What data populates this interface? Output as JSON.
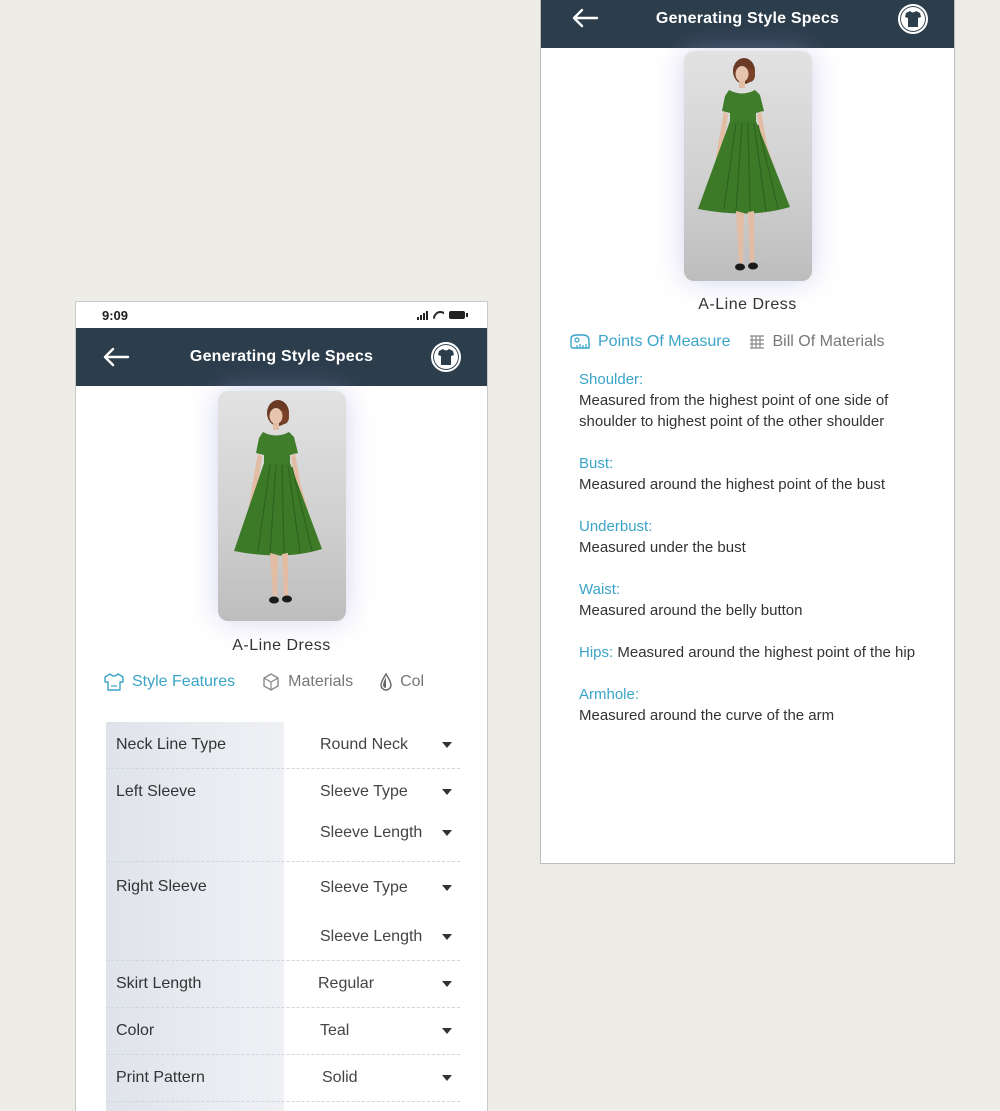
{
  "left_phone": {
    "status_bar": {
      "time": "9:09"
    },
    "header": {
      "title": "Generating Style Specs"
    },
    "product_name": "A-Line Dress",
    "tabs": [
      {
        "label": "Style Features",
        "icon": "shirt-outline-icon",
        "active": true
      },
      {
        "label": "Materials",
        "icon": "fabric-roll-icon",
        "active": false
      },
      {
        "label": "Col",
        "icon": "drop-icon",
        "active": false
      }
    ],
    "specs": [
      {
        "label": "Neck Line Type",
        "values": [
          "Round Neck"
        ]
      },
      {
        "label": "Left Sleeve",
        "values": [
          "Sleeve Type",
          "Sleeve Length"
        ]
      },
      {
        "label": "Right Sleeve",
        "values": [
          "Sleeve Type",
          "Sleeve Length"
        ]
      },
      {
        "label": "Skirt Length",
        "values": [
          "Regular"
        ]
      },
      {
        "label": "Color",
        "values": [
          "Teal"
        ]
      },
      {
        "label": "Print Pattern",
        "values": [
          "Solid"
        ]
      }
    ]
  },
  "right_phone": {
    "header": {
      "title": "Generating Style Specs"
    },
    "product_name": "A-Line Dress",
    "tabs": [
      {
        "label": "Points Of Measure",
        "icon": "measuring-tape-icon",
        "active": true
      },
      {
        "label": "Bill Of Materials",
        "icon": "grid-table-icon",
        "active": false
      }
    ],
    "measures": [
      {
        "title": "Shoulder:",
        "text": "Measured from the highest point of one side of shoulder to highest point of the other shoulder",
        "inline": false
      },
      {
        "title": "Bust:",
        "text": "Measured around the highest point of the bust",
        "inline": false
      },
      {
        "title": "Underbust:",
        "text": "Measured under the bust",
        "inline": false
      },
      {
        "title": "Waist:",
        "text": "Measured around the belly button",
        "inline": false
      },
      {
        "title": "Hips:",
        "text": "Measured around the highest point of the hip",
        "inline": true
      },
      {
        "title": "Armhole:",
        "text": "Measured around the curve of the arm",
        "inline": false
      }
    ]
  },
  "colors": {
    "header_bg": "#2c3d4c",
    "accent": "#3aa4c8",
    "dress_green": "#3f7d2a",
    "page_bg": "#edece7"
  }
}
